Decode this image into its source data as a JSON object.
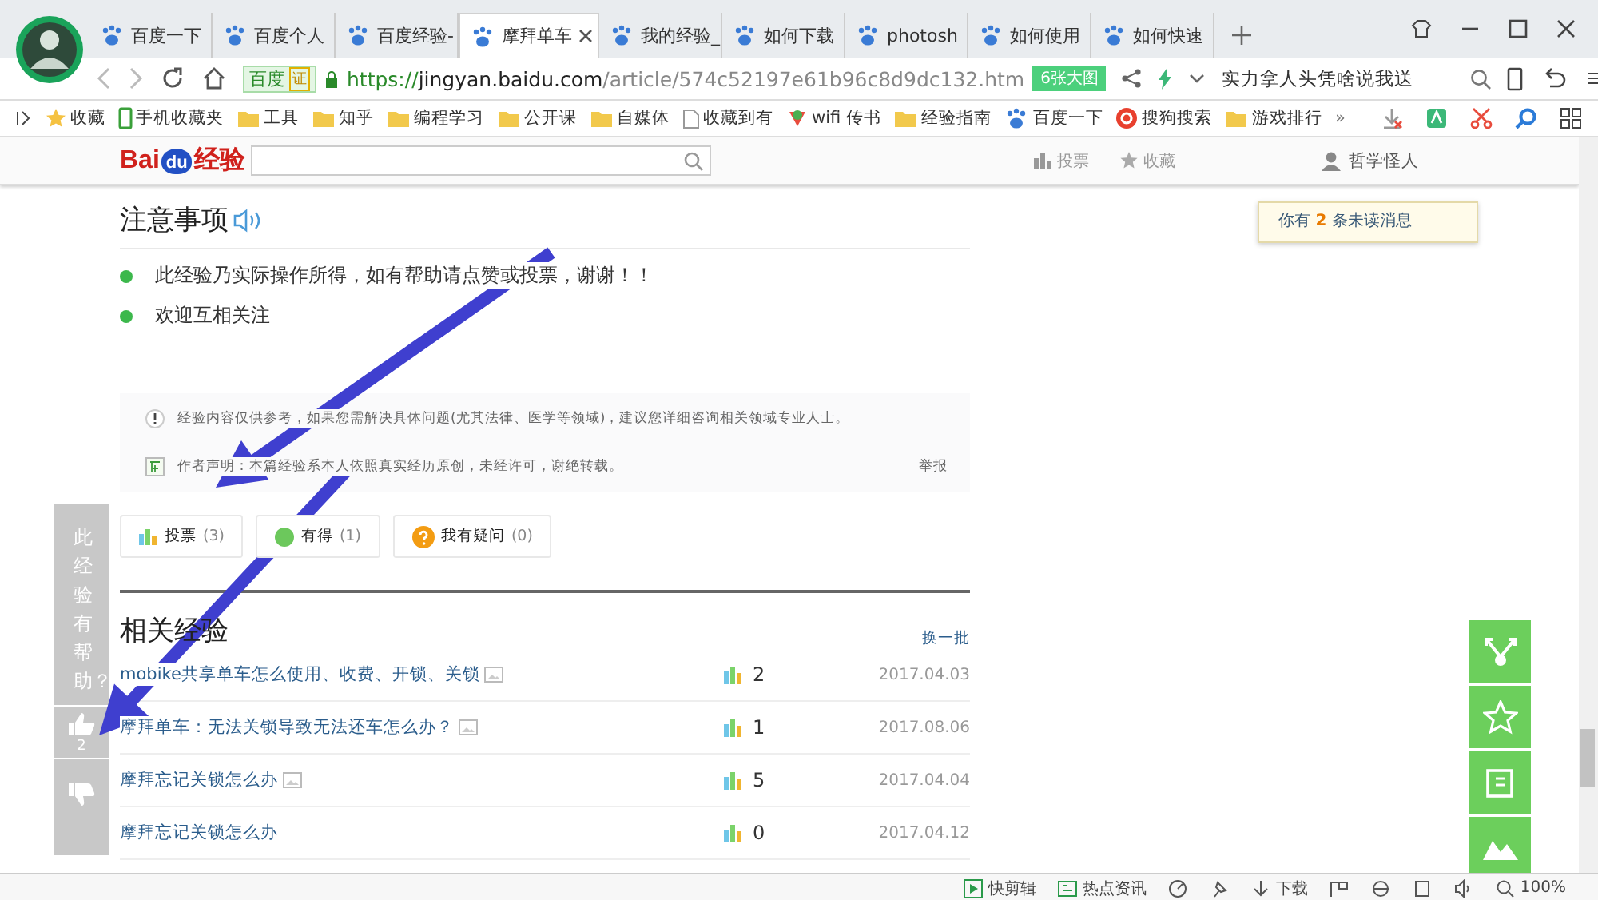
{
  "tabs": [
    {
      "label": "百度一下",
      "selected": false
    },
    {
      "label": "百度个人",
      "selected": false
    },
    {
      "label": "百度经验-",
      "selected": false
    },
    {
      "label": "摩拜单车",
      "selected": true
    },
    {
      "label": "我的经验_",
      "selected": false
    },
    {
      "label": "如何下载",
      "selected": false
    },
    {
      "label": "photosh",
      "selected": false
    },
    {
      "label": "如何使用",
      "selected": false
    },
    {
      "label": "如何快速",
      "selected": false
    }
  ],
  "address_bar": {
    "site_badge": "百度",
    "badge_mark": "证",
    "url_scheme": "https://",
    "url_host": "jingyan.baidu.com",
    "url_path": "/article/574c52197e61b96c8d9dc132.htm",
    "image_button": "6张大图",
    "search_value": "实力拿人头凭啥说我送"
  },
  "bookmarks": [
    {
      "label": "收藏",
      "kind": "star"
    },
    {
      "label": "手机收藏夹",
      "kind": "phone"
    },
    {
      "label": "工具",
      "kind": "folder"
    },
    {
      "label": "知乎",
      "kind": "folder"
    },
    {
      "label": "编程学习",
      "kind": "folder"
    },
    {
      "label": "公开课",
      "kind": "folder"
    },
    {
      "label": "自媒体",
      "kind": "folder"
    },
    {
      "label": "收藏到有",
      "kind": "page"
    },
    {
      "label": "wifi 传书",
      "kind": "app"
    },
    {
      "label": "经验指南",
      "kind": "folder"
    },
    {
      "label": "百度一下",
      "kind": "paw"
    },
    {
      "label": "搜狗搜索",
      "kind": "sogou"
    },
    {
      "label": "游戏排行",
      "kind": "folder"
    },
    {
      "label": "»",
      "kind": "more"
    }
  ],
  "site_header": {
    "logo": "Bai",
    "logo_mark": "du",
    "logo_suffix": "经验",
    "nav": [
      {
        "label": "投票",
        "kind": "vote"
      },
      {
        "label": "收藏",
        "kind": "star"
      }
    ],
    "user": "哲学怪人",
    "message_popup": "你有 **2** 条未读消息"
  },
  "notes": {
    "title": "注意事项",
    "items": [
      "此经验乃实际操作所得，如有帮助请点赞或投票，谢谢！！",
      "欢迎互相关注"
    ]
  },
  "disclaimer": {
    "notice": "经验内容仅供参考，如果您需解决具体问题(尤其法律、医学等领域)，建议您详细咨询相关领域专业人士。",
    "statement": "作者声明：本篇经验系本人依照真实经历原创，未经许可，谢绝转载。",
    "report": "举报"
  },
  "actions": [
    {
      "label": "投票",
      "count": "(3)",
      "kind": "vote"
    },
    {
      "label": "有得",
      "count": "(1)",
      "kind": "got"
    },
    {
      "label": "我有疑问",
      "count": "(0)",
      "kind": "question"
    }
  ],
  "related": {
    "title": "相关经验",
    "refresh": "换一批",
    "rows": [
      {
        "title": "mobike共享单车怎么使用、收费、开锁、关锁",
        "has_image": true,
        "votes": "2",
        "date": "2017.04.03"
      },
      {
        "title": "摩拜单车：无法关锁导致无法还车怎么办？",
        "has_image": true,
        "votes": "1",
        "date": "2017.08.06"
      },
      {
        "title": "摩拜忘记关锁怎么办",
        "has_image": true,
        "votes": "5",
        "date": "2017.04.04"
      },
      {
        "title": "摩拜忘记关锁怎么办",
        "has_image": false,
        "votes": "0",
        "date": "2017.04.12"
      }
    ]
  },
  "helpful_bar": {
    "prompt": "此经验有帮助？",
    "up_count": "2"
  },
  "float_buttons": [
    {
      "kind": "share"
    },
    {
      "kind": "star"
    },
    {
      "kind": "edit"
    },
    {
      "kind": "mountain"
    }
  ],
  "status_bar": {
    "items": [
      {
        "label": "快剪辑",
        "kind": "clip"
      },
      {
        "label": "热点资讯",
        "kind": "news"
      },
      {
        "kind": "speed"
      },
      {
        "kind": "pin"
      },
      {
        "label": "下载",
        "kind": "download"
      },
      {
        "kind": "flag"
      },
      {
        "kind": "ie"
      },
      {
        "kind": "window"
      },
      {
        "kind": "sound"
      },
      {
        "label": "100%",
        "kind": "zoom"
      }
    ]
  }
}
